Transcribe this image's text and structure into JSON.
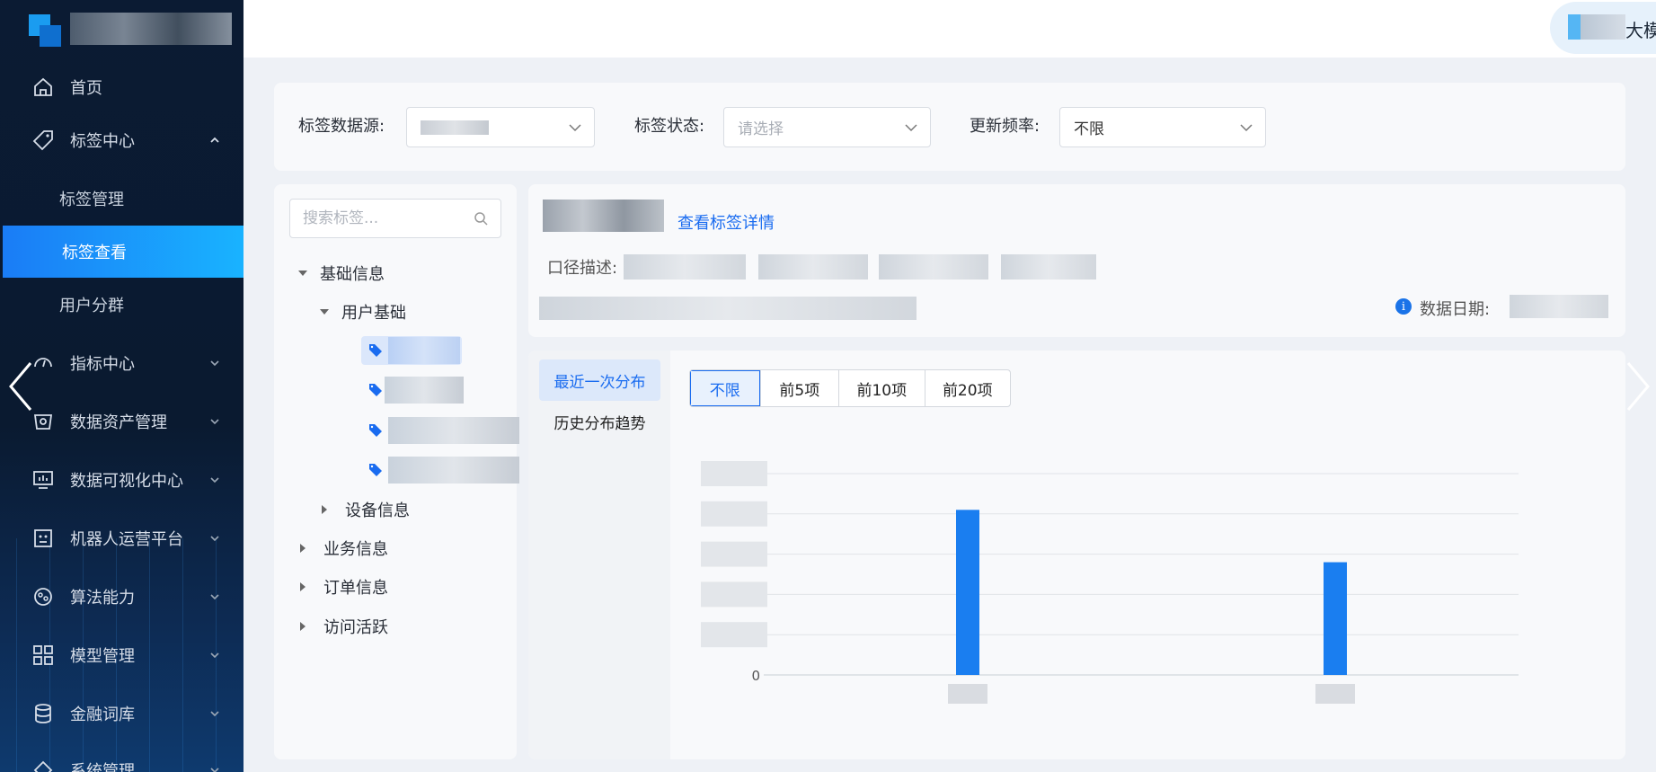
{
  "sidebar": {
    "menu": [
      {
        "label": "首页",
        "icon": "home-icon"
      },
      {
        "label": "标签中心",
        "icon": "tag-icon"
      },
      {
        "label": "指标中心",
        "icon": "gauge-icon"
      },
      {
        "label": "数据资产管理",
        "icon": "asset-icon"
      },
      {
        "label": "数据可视化中心",
        "icon": "monitor-icon"
      },
      {
        "label": "机器人运营平台",
        "icon": "robot-icon"
      },
      {
        "label": "算法能力",
        "icon": "algorithm-icon"
      },
      {
        "label": "模型管理",
        "icon": "grid-icon"
      },
      {
        "label": "金融词库",
        "icon": "database-icon"
      },
      {
        "label": "系统管理",
        "icon": "settings-icon"
      }
    ],
    "submenu": [
      {
        "label": "标签管理"
      },
      {
        "label": "标签查看"
      },
      {
        "label": "用户分群"
      }
    ]
  },
  "header": {
    "model_label": "大模型"
  },
  "filters": {
    "source_label": "标签数据源:",
    "status_label": "标签状态:",
    "status_placeholder": "请选择",
    "freq_label": "更新频率:",
    "freq_value": "不限"
  },
  "tree": {
    "search_placeholder": "搜索标签...",
    "nodes": {
      "basic": "基础信息",
      "user_basic": "用户基础",
      "device": "设备信息",
      "business": "业务信息",
      "order": "订单信息",
      "visit": "访问活跃"
    }
  },
  "info": {
    "detail_link": "查看标签详情",
    "desc_label": "口径描述:",
    "date_label": "数据日期:"
  },
  "chart": {
    "tabs": [
      "最近一次分布",
      "历史分布趋势"
    ],
    "segments": [
      "不限",
      "前5项",
      "前10项",
      "前20项"
    ],
    "y_zero_label": "0"
  },
  "chart_data": {
    "type": "bar",
    "categories": [
      "",
      ""
    ],
    "values": [
      4.1,
      2.8
    ],
    "ylim": [
      0,
      5
    ],
    "grid": true
  },
  "colors": {
    "accent": "#1a6cf0",
    "bar": "#1a7ef0"
  }
}
